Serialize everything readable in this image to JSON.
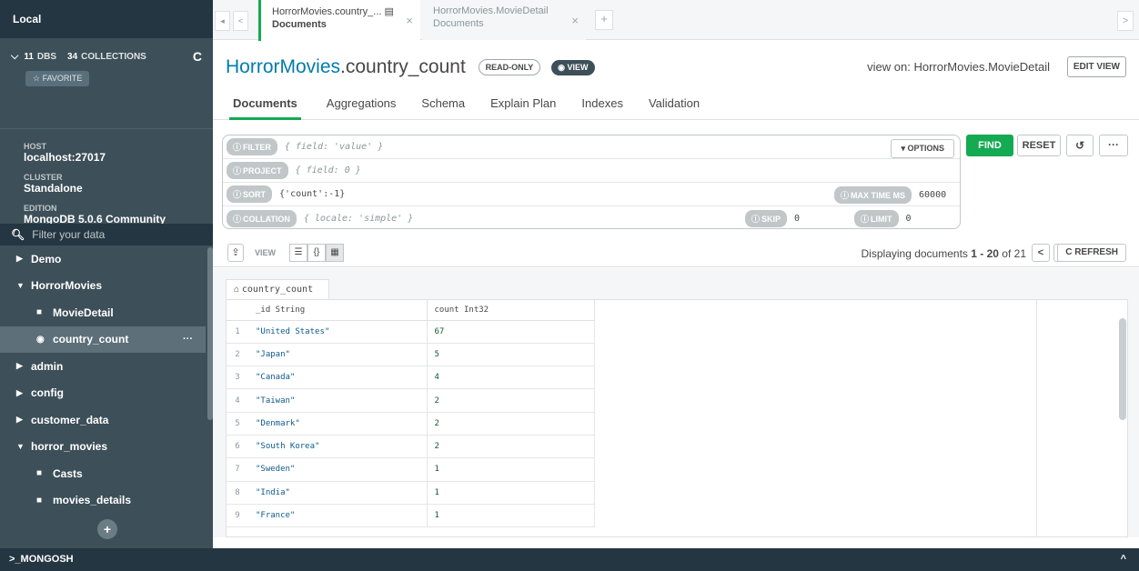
{
  "sidebar": {
    "title": "Local",
    "dbs_count": "11",
    "dbs_label": "DBS",
    "collections_count": "34",
    "collections_label": "COLLECTIONS",
    "favorite_label": "☆ FAVORITE",
    "host_key": "HOST",
    "host_value": "localhost:27017",
    "cluster_key": "CLUSTER",
    "cluster_value": "Standalone",
    "edition_key": "EDITION",
    "edition_value": "MongoDB 5.0.6 Community",
    "filter_placeholder": "Filter your data",
    "tree": [
      {
        "label": "Demo",
        "kind": "db",
        "expanded": false
      },
      {
        "label": "HorrorMovies",
        "kind": "db",
        "expanded": true
      },
      {
        "label": "MovieDetail",
        "kind": "collection"
      },
      {
        "label": "country_count",
        "kind": "view",
        "active": true
      },
      {
        "label": "admin",
        "kind": "db",
        "expanded": false
      },
      {
        "label": "config",
        "kind": "db",
        "expanded": false
      },
      {
        "label": "customer_data",
        "kind": "db",
        "expanded": false
      },
      {
        "label": "horror_movies",
        "kind": "db",
        "expanded": true
      },
      {
        "label": "Casts",
        "kind": "collection"
      },
      {
        "label": "movies_details",
        "kind": "collection"
      }
    ]
  },
  "tabs": [
    {
      "line1": "HorrorMovies.country_...",
      "line2": "Documents",
      "active": true
    },
    {
      "line1": "HorrorMovies.MovieDetail",
      "line2": "Documents",
      "active": false
    }
  ],
  "header": {
    "db": "HorrorMovies",
    "collection": ".country_count",
    "readonly_badge": "READ-ONLY",
    "view_badge": "VIEW",
    "view_on": "view on: HorrorMovies.MovieDetail",
    "edit_view": "EDIT VIEW"
  },
  "subtabs": [
    "Documents",
    "Aggregations",
    "Schema",
    "Explain Plan",
    "Indexes",
    "Validation"
  ],
  "query": {
    "filter_label": "FILTER",
    "filter_placeholder": "{ field: 'value' }",
    "options_label": "▾ OPTIONS",
    "project_label": "PROJECT",
    "project_placeholder": "{ field: 0 }",
    "sort_label": "SORT",
    "sort_value": "{'count':-1}",
    "maxtime_label": "MAX TIME MS",
    "maxtime_value": "60000",
    "collation_label": "COLLATION",
    "collation_placeholder": "{ locale: 'simple' }",
    "skip_label": "SKIP",
    "skip_value": "0",
    "limit_label": "LIMIT",
    "limit_value": "0",
    "find": "FIND",
    "reset": "RESET"
  },
  "toolbar": {
    "view_label": "VIEW",
    "displaying_prefix": "Displaying documents",
    "range": "1 - 20",
    "of_text": "of 21",
    "refresh": "REFRESH"
  },
  "grid": {
    "tab_label": "country_count",
    "columns": [
      "_id String",
      "count Int32"
    ],
    "rows": [
      [
        "1",
        "\"United States\"",
        "67"
      ],
      [
        "2",
        "\"Japan\"",
        "5"
      ],
      [
        "3",
        "\"Canada\"",
        "4"
      ],
      [
        "4",
        "\"Taiwan\"",
        "2"
      ],
      [
        "5",
        "\"Denmark\"",
        "2"
      ],
      [
        "6",
        "\"South Korea\"",
        "2"
      ],
      [
        "7",
        "\"Sweden\"",
        "1"
      ],
      [
        "8",
        "\"India\"",
        "1"
      ],
      [
        "9",
        "\"France\"",
        "1"
      ]
    ]
  },
  "shell": {
    "label": ">_MONGOSH"
  }
}
